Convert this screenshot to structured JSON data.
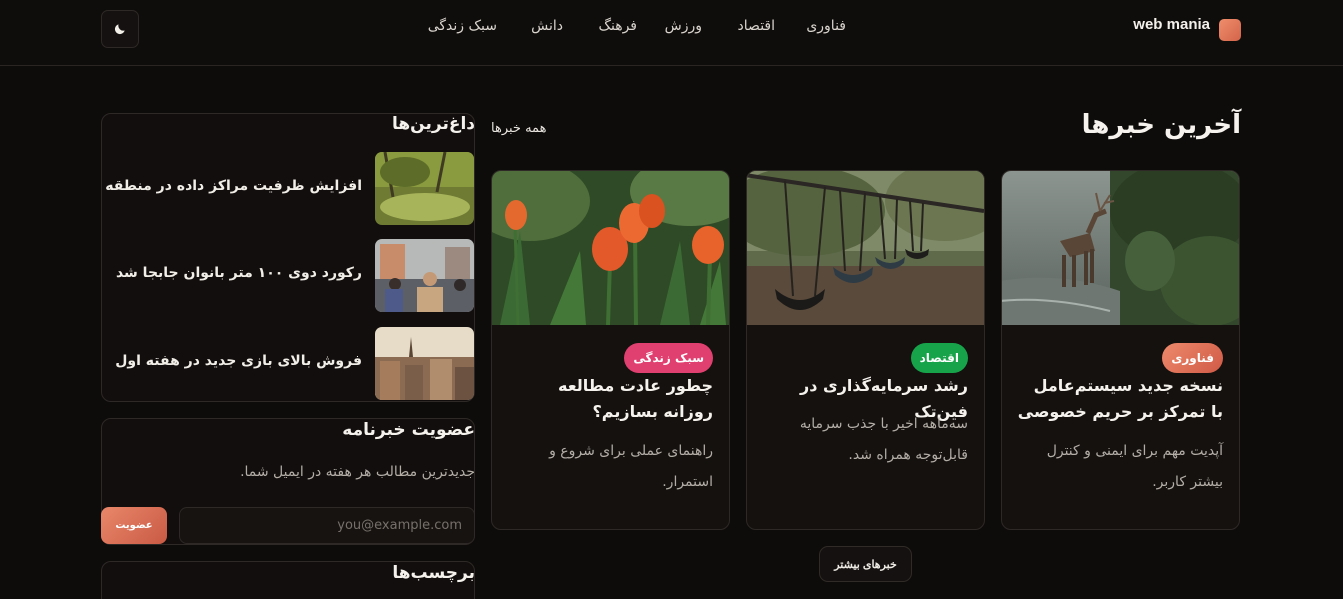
{
  "header": {
    "logo_text": "web mania",
    "nav": [
      "فناوری",
      "اقتصاد",
      "ورزش",
      "فرهنگ",
      "دانش",
      "سبک زندگی"
    ]
  },
  "main": {
    "title": "آخرین خبرها",
    "all_news_link": "همه خبرها",
    "cards": [
      {
        "badge": "فناوری",
        "badge_color": "#e2705b",
        "title": "نسخه جدید سیستم‌عامل با تمرکز بر حریم خصوصی",
        "desc": "آپدیت مهم برای ایمنی و کنترل بیشتر کاربر.",
        "image": "deer-in-stream"
      },
      {
        "badge": "اقتصاد",
        "badge_color": "#17a34a",
        "title": "رشد سرمایه‌گذاری در فین‌تک",
        "desc": "سه‌ماهه اخیر با جذب سرمایه قابل‌توجه همراه شد.",
        "image": "playground-swings"
      },
      {
        "badge": "سبک زندگی",
        "badge_color": "#e0406f",
        "title": "چطور عادت مطالعه روزانه بسازیم؟",
        "desc": "راهنمای عملی برای شروع و استمرار.",
        "image": "orange-tulips"
      }
    ],
    "more_button": "خبرهای بیشتر"
  },
  "sidebar": {
    "trending_title": "داغ‌ترین‌ها",
    "trending": [
      {
        "text": "افزایش ظرفیت مراکز داده در منطقه",
        "image": "forest-moss"
      },
      {
        "text": "رکورد دوی ۱۰۰ متر بانوان جابجا شد",
        "image": "street-crowd"
      },
      {
        "text": "فروش بالای بازی جدید در هفته اول",
        "image": "city-rooftops"
      }
    ],
    "newsletter": {
      "title": "عضویت خبرنامه",
      "desc": "جدیدترین مطالب هر هفته در ایمیل شما.",
      "email_placeholder": "you@example.com",
      "subscribe_label": "عضویت"
    },
    "tags_title": "برچسب‌ها"
  },
  "colors": {
    "background": "#0e0c0b",
    "accent": "#e2705b"
  }
}
